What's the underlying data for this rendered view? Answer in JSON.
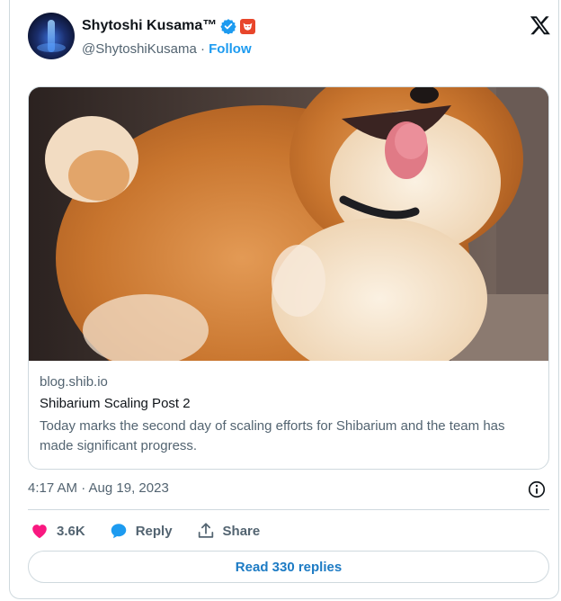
{
  "author": {
    "name": "Shytoshi Kusama™",
    "handle": "@ShytoshiKusama",
    "separator": "·",
    "follow_label": "Follow"
  },
  "link_card": {
    "domain": "blog.shib.io",
    "title": "Shibarium Scaling Post 2",
    "description": "Today marks the second day of scaling efforts for Shibarium and the team has made significant progress."
  },
  "timestamp": "4:17 AM · Aug 19, 2023",
  "actions": {
    "like_count": "3.6K",
    "reply_label": "Reply",
    "share_label": "Share"
  },
  "read_replies_label": "Read 330 replies",
  "colors": {
    "accent": "#1d9bf0",
    "like": "#f91880",
    "text_secondary": "#536471",
    "border": "#cfd9de"
  },
  "icons": [
    "verified-badge-icon",
    "shiba-badge-icon",
    "x-logo-icon",
    "info-icon",
    "heart-icon",
    "reply-bubble-icon",
    "share-icon"
  ]
}
